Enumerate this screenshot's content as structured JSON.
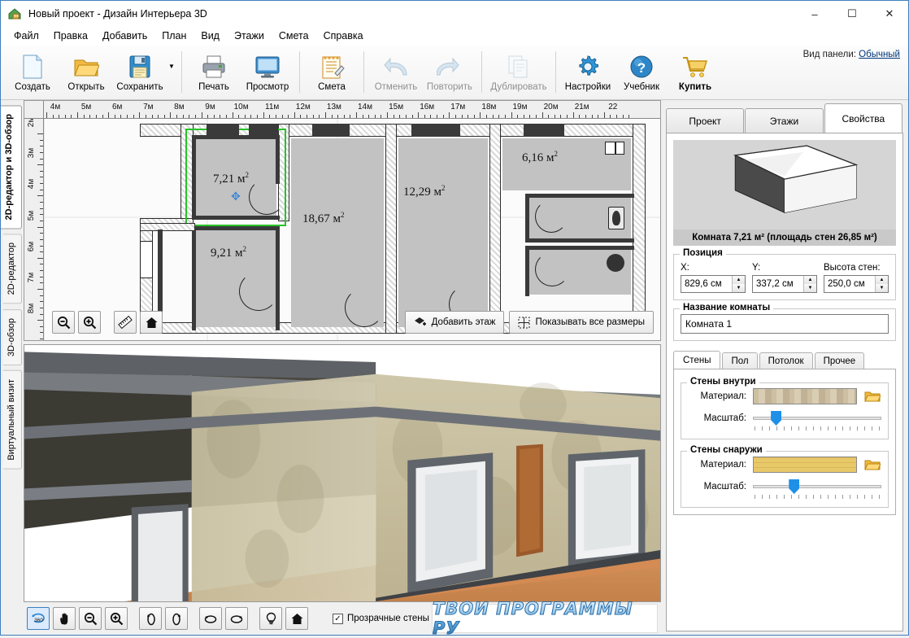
{
  "window": {
    "title": "Новый проект - Дизайн Интерьера 3D",
    "minimize": "–",
    "maximize": "☐",
    "close": "✕"
  },
  "menu": [
    "Файл",
    "Правка",
    "Добавить",
    "План",
    "Вид",
    "Этажи",
    "Смета",
    "Справка"
  ],
  "toolbar": {
    "buttons": [
      {
        "label": "Создать",
        "icon": "new-document-icon",
        "disabled": false
      },
      {
        "label": "Открыть",
        "icon": "open-folder-icon",
        "disabled": false
      },
      {
        "label": "Сохранить",
        "icon": "save-floppy-icon",
        "disabled": false
      },
      {
        "label": "Печать",
        "icon": "printer-icon",
        "disabled": false
      },
      {
        "label": "Просмотр",
        "icon": "monitor-preview-icon",
        "disabled": false
      },
      {
        "label": "Смета",
        "icon": "estimate-notepad-icon",
        "disabled": false
      },
      {
        "label": "Отменить",
        "icon": "undo-arrow-icon",
        "disabled": true
      },
      {
        "label": "Повторить",
        "icon": "redo-arrow-icon",
        "disabled": true
      },
      {
        "label": "Дублировать",
        "icon": "duplicate-pages-icon",
        "disabled": true
      },
      {
        "label": "Настройки",
        "icon": "gear-icon",
        "disabled": false
      },
      {
        "label": "Учебник",
        "icon": "question-help-icon",
        "disabled": false
      },
      {
        "label": "Купить",
        "icon": "shopping-cart-icon",
        "disabled": false
      }
    ],
    "panel_view_label": "Вид панели:",
    "panel_view_value": "Обычный"
  },
  "left_tabs": [
    {
      "label": "2D-редактор и 3D-обзор",
      "active": true
    },
    {
      "label": "2D-редактор",
      "active": false
    },
    {
      "label": "3D-обзор",
      "active": false
    },
    {
      "label": "Виртуальный визит",
      "active": false
    }
  ],
  "plan2d": {
    "ruler_h_labels": [
      "4м",
      "5м",
      "6м",
      "7м",
      "8м",
      "9м",
      "10м",
      "11м",
      "12м",
      "13м",
      "14м",
      "15м",
      "16м",
      "17м",
      "18м",
      "19м",
      "20м",
      "21м",
      "22"
    ],
    "ruler_v_labels": [
      "2м",
      "3м",
      "4м",
      "5м",
      "6м",
      "7м",
      "8м"
    ],
    "rooms": [
      {
        "area": "7,21",
        "unit": "м",
        "selected": true
      },
      {
        "area": "9,21",
        "unit": "м",
        "selected": false
      },
      {
        "area": "18,67",
        "unit": "м",
        "selected": false
      },
      {
        "area": "12,29",
        "unit": "м",
        "selected": false
      },
      {
        "area": "6,16",
        "unit": "м",
        "selected": false
      }
    ],
    "toolbar_icons": [
      "zoom-out-icon",
      "zoom-in-icon",
      "ruler-measure-icon",
      "home-reset-icon"
    ],
    "add_floor_label": "Добавить этаж",
    "show_dimensions_label": "Показывать все размеры"
  },
  "view3d": {
    "toolbar_icons": [
      "orbit-360-icon",
      "pan-hand-icon",
      "zoom-out-icon",
      "zoom-in-icon",
      "rotate-vertical-left-icon",
      "rotate-vertical-right-icon",
      "rotate-horizontal-left-icon",
      "rotate-horizontal-right-icon",
      "light-bulb-icon",
      "home-reset-icon"
    ],
    "transparent_walls_label": "Прозрачные стены",
    "transparent_walls_checked": true,
    "virtual_visit_label": "Виртуальный визит",
    "watermark": "ТВОИ ПРОГРАММЫ РУ"
  },
  "properties": {
    "tabs": [
      {
        "label": "Проект",
        "active": false
      },
      {
        "label": "Этажи",
        "active": false
      },
      {
        "label": "Свойства",
        "active": true
      }
    ],
    "preview_caption": "Комната 7,21 м²  (площадь стен 26,85 м²)",
    "position": {
      "group_label": "Позиция",
      "x_label": "X:",
      "x_value": "829,6 см",
      "y_label": "Y:",
      "y_value": "337,2 см",
      "height_label": "Высота стен:",
      "height_value": "250,0 см"
    },
    "room_name": {
      "group_label": "Название комнаты",
      "value": "Комната 1"
    },
    "surface_tabs": [
      {
        "label": "Стены",
        "active": true
      },
      {
        "label": "Пол",
        "active": false
      },
      {
        "label": "Потолок",
        "active": false
      },
      {
        "label": "Прочее",
        "active": false
      }
    ],
    "walls_inside": {
      "group_label": "Стены внутри",
      "material_label": "Материал:",
      "scale_label": "Масштаб:",
      "scale_percent": 14
    },
    "walls_outside": {
      "group_label": "Стены снаружи",
      "material_label": "Материал:",
      "scale_label": "Масштаб:",
      "scale_percent": 28
    }
  },
  "colors": {
    "accent": "#1e90e8",
    "selection": "#28c328",
    "window_border": "#3f7fbf"
  }
}
